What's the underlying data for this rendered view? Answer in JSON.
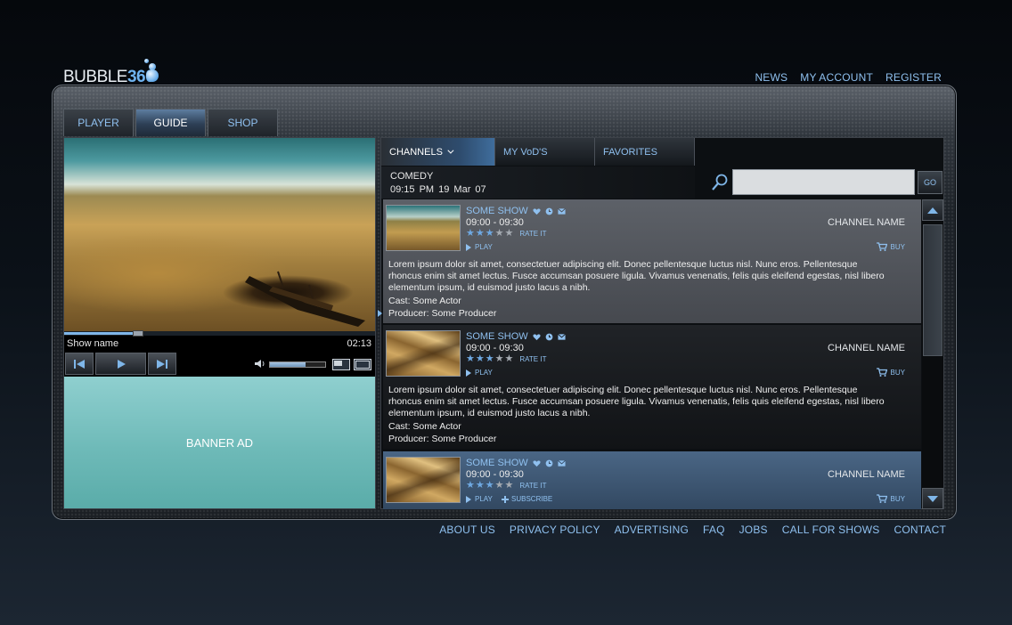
{
  "brand": {
    "logo_text": "BUBBLE",
    "logo_num": "360"
  },
  "top_nav": [
    "NEWS",
    "MY ACCOUNT",
    "REGISTER"
  ],
  "main_tabs": [
    "PLAYER",
    "GUIDE",
    "SHOP"
  ],
  "active_main_tab": "GUIDE",
  "player": {
    "show_name": "Show name",
    "time": "02:13",
    "progress": 0.25,
    "volume": 0.65,
    "banner": "BANNER AD"
  },
  "guide": {
    "sub_tabs": [
      "CHANNELS",
      "MY VoD'S",
      "FAVORITES"
    ],
    "genre": "COMEDY",
    "datetime": "09:15 PM   19 Mar 07",
    "search_placeholder": "",
    "go_label": "GO",
    "items": [
      {
        "title": "SOME SHOW",
        "time": "09:00 - 09:30",
        "rating": 3,
        "rate_label": "RATE IT",
        "play_label": "PLAY",
        "channel": "CHANNEL NAME",
        "buy_label": "BUY",
        "description": "Lorem ipsum dolor sit amet, consectetuer adipiscing elit. Donec pellentesque luctus nisl. Nunc eros. Pellentesque rhoncus enim sit amet lectus. Fusce accumsan posuere ligula. Vivamus venenatis, felis quis eleifend egestas, nisl libero elementum ipsum, id euismod justo lacus a nibh.",
        "cast": "Cast: Some Actor",
        "producer": "Producer: Some Producer"
      },
      {
        "title": "SOME SHOW",
        "time": "09:00 - 09:30",
        "rating": 3,
        "rate_label": "RATE IT",
        "play_label": "PLAY",
        "channel": "CHANNEL NAME",
        "buy_label": "BUY",
        "description": "Lorem ipsum dolor sit amet, consectetuer adipiscing elit. Donec pellentesque luctus nisl. Nunc eros. Pellentesque rhoncus enim sit amet lectus. Fusce accumsan posuere ligula. Vivamus venenatis, felis quis eleifend egestas, nisl libero elementum ipsum, id euismod justo lacus a nibh.",
        "cast": "Cast: Some Actor",
        "producer": "Producer: Some Producer"
      },
      {
        "title": "SOME SHOW",
        "time": "09:00 - 09:30",
        "rating": 3,
        "rate_label": "RATE IT",
        "play_label": "PLAY",
        "subscribe_label": "SUBSCRIBE",
        "channel": "CHANNEL NAME",
        "buy_label": "BUY"
      }
    ]
  },
  "footer": [
    "ABOUT US",
    "PRIVACY POLICY",
    "ADVERTISING",
    "FAQ",
    "JOBS",
    "CALL FOR SHOWS",
    "CONTACT"
  ],
  "colors": {
    "accent": "#8fc0ef",
    "star_on": "#6fa9e2",
    "star_off": "#a5abb2"
  }
}
